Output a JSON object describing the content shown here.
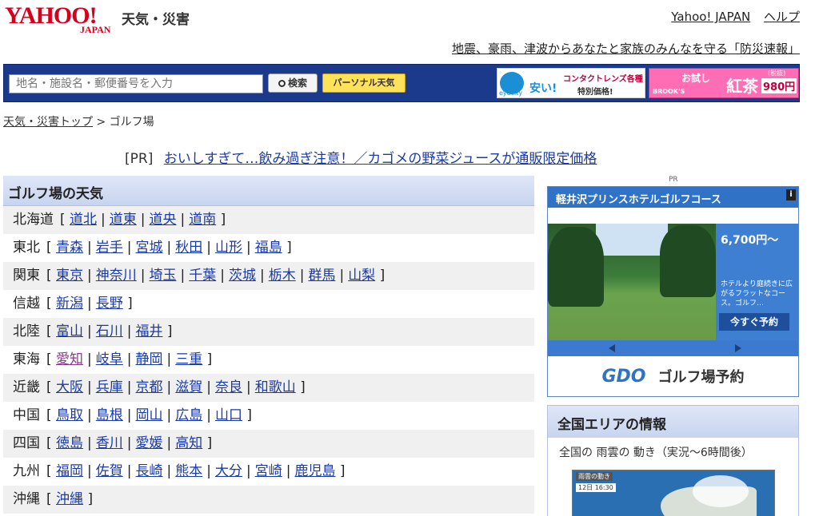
{
  "header": {
    "logo_main": "YAHOO!",
    "logo_sub": "JAPAN",
    "site_name": "天気・災害",
    "links": [
      "Yahoo! JAPAN",
      "ヘルプ"
    ],
    "disaster_link": "地震、豪雨、津波からあなたと家族のみんなを守る「防災速報」"
  },
  "search": {
    "placeholder": "地名・施設名・郵便番号を入力",
    "button": "検索",
    "personal_button": "パーソナル天気"
  },
  "ads_top": {
    "ad1": {
      "brand": "eyecity",
      "cheap": "安い!",
      "lens": "コンタクトレンズ各種",
      "price": "特別価格!"
    },
    "ad2": {
      "brand": "BROOK'S",
      "try": "お試し",
      "product": "紅茶",
      "price": "980円",
      "tax": "(税抜)"
    }
  },
  "breadcrumb": {
    "home": "天気・災害トップ",
    "sep": ">",
    "current": "ゴルフ場"
  },
  "pr": {
    "label": "[PR]",
    "text": "おいしすぎて…飲み過ぎ注意！／カゴメの野菜ジュースが通販限定価格"
  },
  "golf": {
    "title": "ゴルフ場の天気",
    "regions": [
      {
        "name": "北海道",
        "prefs": [
          "道北",
          "道東",
          "道央",
          "道南"
        ]
      },
      {
        "name": "東北",
        "prefs": [
          "青森",
          "岩手",
          "宮城",
          "秋田",
          "山形",
          "福島"
        ]
      },
      {
        "name": "関東",
        "prefs": [
          "東京",
          "神奈川",
          "埼玉",
          "千葉",
          "茨城",
          "栃木",
          "群馬",
          "山梨"
        ]
      },
      {
        "name": "信越",
        "prefs": [
          "新潟",
          "長野"
        ]
      },
      {
        "name": "北陸",
        "prefs": [
          "富山",
          "石川",
          "福井"
        ]
      },
      {
        "name": "東海",
        "prefs": [
          "愛知",
          "岐阜",
          "静岡",
          "三重"
        ]
      },
      {
        "name": "近畿",
        "prefs": [
          "大阪",
          "兵庫",
          "京都",
          "滋賀",
          "奈良",
          "和歌山"
        ]
      },
      {
        "name": "中国",
        "prefs": [
          "鳥取",
          "島根",
          "岡山",
          "広島",
          "山口"
        ]
      },
      {
        "name": "四国",
        "prefs": [
          "徳島",
          "香川",
          "愛媛",
          "高知"
        ]
      },
      {
        "name": "九州",
        "prefs": [
          "福岡",
          "佐賀",
          "長崎",
          "熊本",
          "大分",
          "宮崎",
          "鹿児島"
        ]
      },
      {
        "name": "沖縄",
        "prefs": [
          "沖縄"
        ]
      }
    ]
  },
  "golf_ad": {
    "pr": "PR",
    "title": "軽井沢プリンスホテルゴルフコース",
    "price": "6,700円～",
    "desc": "ホテルより庭続きに広がるフラットなコース。ゴルフ…",
    "reserve": "今すぐ予約",
    "brand": "GDO",
    "service": "ゴルフ場予約"
  },
  "area": {
    "title": "全国エリアの情報",
    "subtitle": "全国の 雨雲の 動き（実況～6時間後）",
    "radar_caption": "雨雲の動き",
    "radar_time": "12日 16:30"
  }
}
